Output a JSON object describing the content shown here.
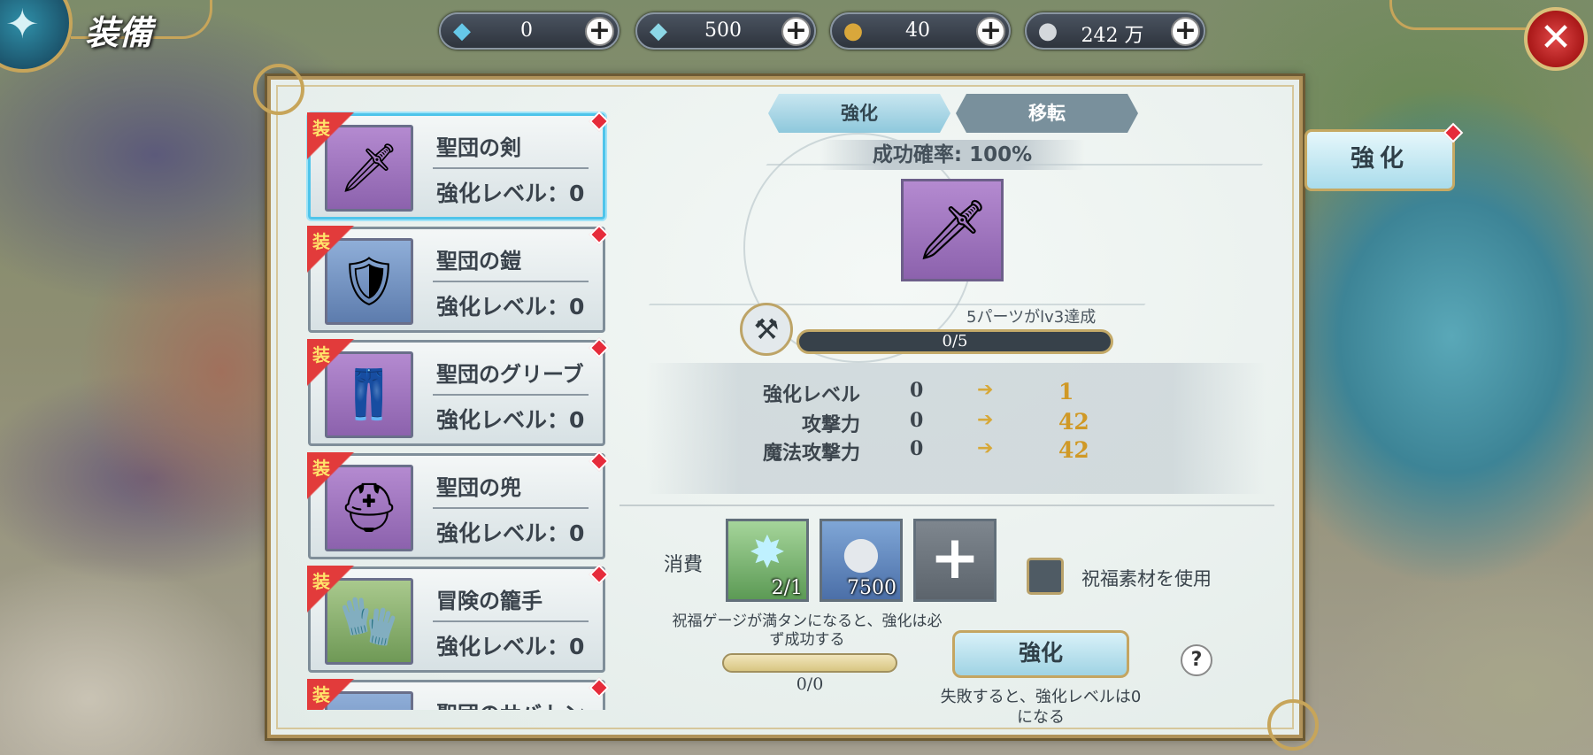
{
  "header": {
    "title": "装備"
  },
  "resources": [
    {
      "icon": "blue-crystal-icon",
      "value": "0"
    },
    {
      "icon": "locked-crystal-icon",
      "value": "500"
    },
    {
      "icon": "medal-icon",
      "value": "40"
    },
    {
      "icon": "silver-coin-icon",
      "value": "242 万"
    }
  ],
  "equipment_list": [
    {
      "tag": "装",
      "name": "聖団の剣",
      "level": "強化レベル：0",
      "icon": "sword-icon"
    },
    {
      "tag": "装",
      "name": "聖団の鎧",
      "level": "強化レベル：0",
      "icon": "armor-icon"
    },
    {
      "tag": "装",
      "name": "聖団のグリーブ",
      "level": "強化レベル：0",
      "icon": "greaves-icon"
    },
    {
      "tag": "装",
      "name": "聖団の兜",
      "level": "強化レベル：0",
      "icon": "helmet-icon"
    },
    {
      "tag": "装",
      "name": "冒険の籠手",
      "level": "強化レベル：0",
      "icon": "gauntlet-icon"
    },
    {
      "tag": "装",
      "name": "聖団のサバトン",
      "level": "",
      "icon": "sabaton-icon"
    }
  ],
  "tabs": [
    {
      "label": "強化",
      "active": true
    },
    {
      "label": "移転",
      "active": false
    }
  ],
  "success_rate": "成功確率: 100%",
  "progress": {
    "note": "5パーツがlv3達成",
    "value": "0/5",
    "fraction": 0
  },
  "stats": [
    {
      "label": "強化レベル",
      "from": "0",
      "to": "1"
    },
    {
      "label": "攻撃力",
      "from": "0",
      "to": "42"
    },
    {
      "label": "魔法攻撃力",
      "from": "0",
      "to": "42"
    }
  ],
  "consume": {
    "label": "消費",
    "materials": [
      {
        "icon": "blue-star-crystal-icon",
        "qty": "2/1"
      },
      {
        "icon": "silver-coin-icon",
        "qty": "7500"
      },
      {
        "icon": "plus-icon",
        "qty": ""
      }
    ],
    "bless_checkbox_label": "祝福素材を使用"
  },
  "bless": {
    "note": "祝福ゲージが満タンになると、強化は必ず成功する",
    "value": "0/0",
    "fraction": 0
  },
  "enhance_button": "強化",
  "help": "?",
  "fail_note": "失敗すると、強化レベルは0になる",
  "side_button": "強化",
  "colors": {
    "accent_gold": "#c7a55a",
    "selected_border": "#4fc4ea",
    "stat_up": "#d09926",
    "badge_red": "#e62b3a"
  }
}
